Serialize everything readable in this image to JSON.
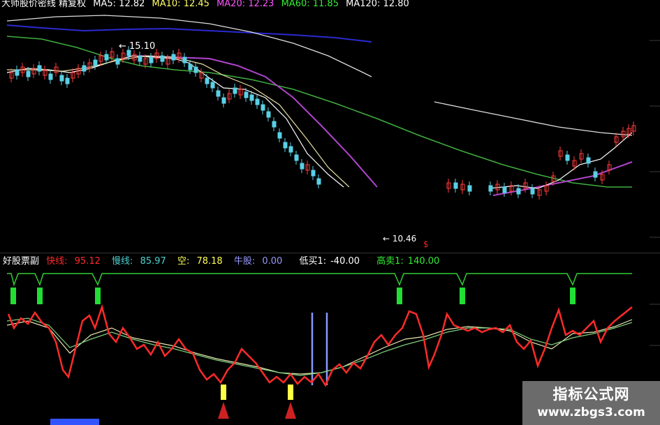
{
  "main_header": {
    "title": "大师股价密线 精复权",
    "ma5": "MA5: 12.82",
    "ma10": "MA10: 12.45",
    "ma20": "MA20: 12.23",
    "ma60": "MA60: 11.85",
    "ma120": "MA120: 12.80"
  },
  "main_chart": {
    "high_label": "← 15.10",
    "low_label": "← 10.46",
    "marker": "$"
  },
  "sub_header": {
    "name": "好股票副",
    "fast_label": "快线:",
    "fast_value": "95.12",
    "slow_label": "慢线:",
    "slow_value": "85.97",
    "empty_label": "空:",
    "empty_value": "78.18",
    "bull_label": "牛股:",
    "bull_value": "0.00",
    "low_buy_label": "低买1:",
    "low_buy_value": "-40.00",
    "high_sell_label": "高卖1:",
    "high_sell_value": "140.00"
  },
  "colors": {
    "fast": "#ff2a2a",
    "slow": "#4fd1d1",
    "empty": "#ffff55",
    "bull": "#9999ff",
    "low_buy": "#ffffff",
    "high_sell": "#33ee33"
  },
  "watermark": {
    "line1": "指标公式网",
    "line2": "www.zbgs3.com"
  }
}
